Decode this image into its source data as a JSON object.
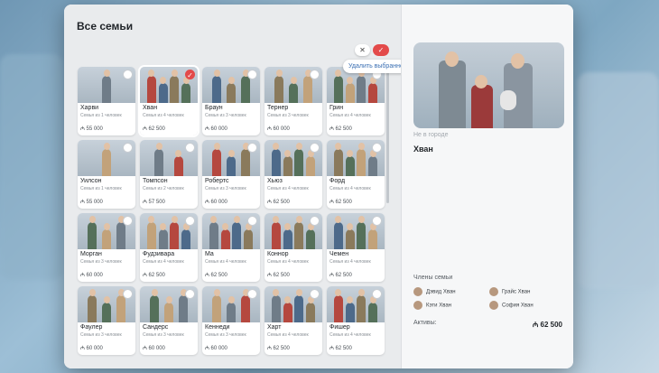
{
  "title": "Все семьи",
  "toolbar": {
    "cancel_icon": "✕",
    "confirm_icon": "✓",
    "tooltip": "Удалить выбранное"
  },
  "close_icon": "✕",
  "families": [
    {
      "name": "Харви",
      "sub": "Семья из 1 человек",
      "price": "₼ 55 000",
      "checked": false
    },
    {
      "name": "Хван",
      "sub": "Семья из 4 человек",
      "price": "₼ 62 500",
      "checked": true
    },
    {
      "name": "Браун",
      "sub": "Семья из 3 человек",
      "price": "₼ 60 000",
      "checked": false
    },
    {
      "name": "Тернер",
      "sub": "Семья из 3 человек",
      "price": "₼ 60 000",
      "checked": false
    },
    {
      "name": "Грин",
      "sub": "Семья из 4 человек",
      "price": "₼ 62 500",
      "checked": false
    },
    {
      "name": "Уилсон",
      "sub": "Семья из 1 человек",
      "price": "₼ 55 000",
      "checked": false
    },
    {
      "name": "Томпсон",
      "sub": "Семья из 2 человек",
      "price": "₼ 57 500",
      "checked": false
    },
    {
      "name": "Робертс",
      "sub": "Семья из 3 человек",
      "price": "₼ 60 000",
      "checked": false
    },
    {
      "name": "Хьюз",
      "sub": "Семья из 4 человек",
      "price": "₼ 62 500",
      "checked": false
    },
    {
      "name": "Форд",
      "sub": "Семья из 4 человек",
      "price": "₼ 62 500",
      "checked": false
    },
    {
      "name": "Морган",
      "sub": "Семья из 3 человек",
      "price": "₼ 60 000",
      "checked": false
    },
    {
      "name": "Фудзивара",
      "sub": "Семья из 4 человек",
      "price": "₼ 62 500",
      "checked": false
    },
    {
      "name": "Ма",
      "sub": "Семья из 4 человек",
      "price": "₼ 62 500",
      "checked": false
    },
    {
      "name": "Коннор",
      "sub": "Семья из 4 человек",
      "price": "₼ 62 500",
      "checked": false
    },
    {
      "name": "Чемен",
      "sub": "Семья из 4 человек",
      "price": "₼ 62 500",
      "checked": false
    },
    {
      "name": "Фаулер",
      "sub": "Семья из 3 человек",
      "price": "₼ 60 000",
      "checked": false
    },
    {
      "name": "Сандерс",
      "sub": "Семья из 3 человек",
      "price": "₼ 60 000",
      "checked": false
    },
    {
      "name": "Кеннеди",
      "sub": "Семья из 3 человек",
      "price": "₼ 60 000",
      "checked": false
    },
    {
      "name": "Харт",
      "sub": "Семья из 4 человек",
      "price": "₼ 62 500",
      "checked": false
    },
    {
      "name": "Фишер",
      "sub": "Семья из 4 человек",
      "price": "₼ 62 500",
      "checked": false
    }
  ],
  "detail": {
    "status": "Не в городе",
    "name": "Хван",
    "members_label": "Члены семьи",
    "members": [
      "Дэвид Хван",
      "Грайс Хван",
      "Кэти Хван",
      "София Хван"
    ],
    "assets_label": "Активы:",
    "assets_value": "₼ 62 500"
  },
  "colors": {
    "accent": "#e34a4a",
    "link": "#3a6fb3"
  }
}
